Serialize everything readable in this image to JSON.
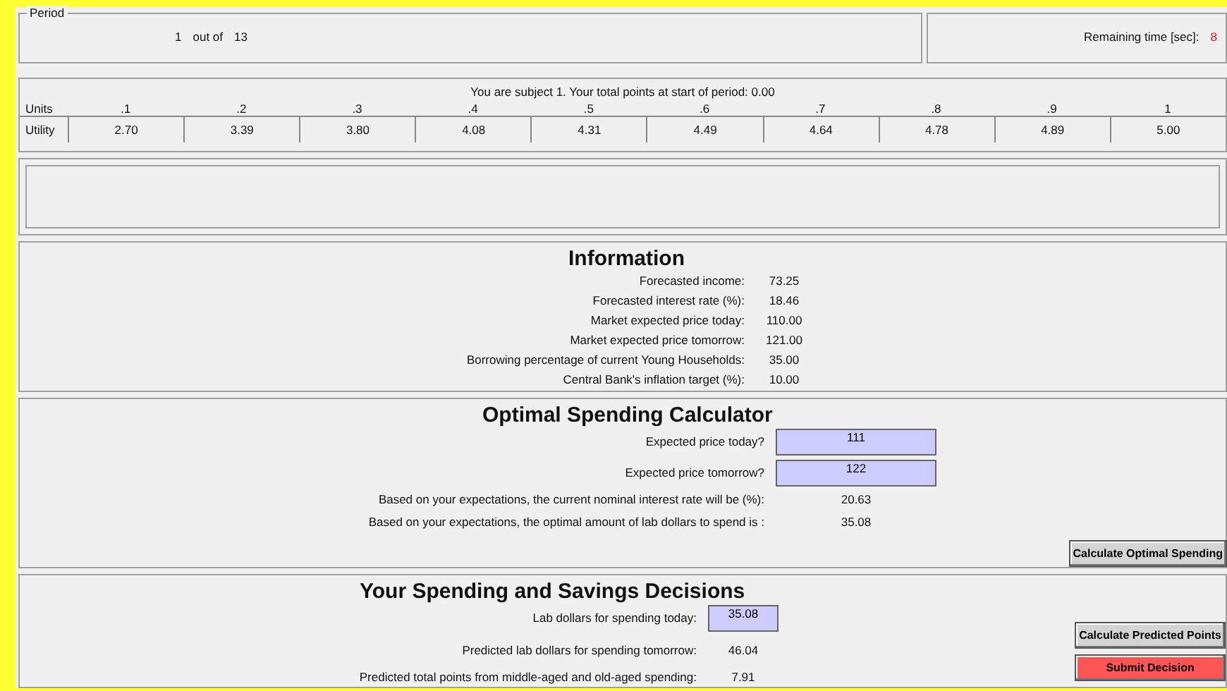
{
  "period": {
    "legend": "Period",
    "current": "1",
    "out_of_label": "out of",
    "total": "13"
  },
  "timer": {
    "label": "Remaining time [sec]:",
    "value": "8"
  },
  "subject_line": "You are subject 1. Your total points at start of period: 0.00",
  "utility_table": {
    "row_headers": [
      "Units",
      "Utility"
    ],
    "units": [
      ".1",
      ".2",
      ".3",
      ".4",
      ".5",
      ".6",
      ".7",
      ".8",
      ".9",
      "1"
    ],
    "utility": [
      "2.70",
      "3.39",
      "3.80",
      "4.08",
      "4.31",
      "4.49",
      "4.64",
      "4.78",
      "4.89",
      "5.00"
    ]
  },
  "information": {
    "title": "Information",
    "rows": [
      {
        "label": "Forecasted income:",
        "value": "73.25"
      },
      {
        "label": "Forecasted interest rate (%):",
        "value": "18.46"
      },
      {
        "label": "Market expected price today:",
        "value": "110.00"
      },
      {
        "label": "Market expected price tomorrow:",
        "value": "121.00"
      },
      {
        "label": "Borrowing percentage of current Young Households:",
        "value": "35.00"
      },
      {
        "label": "Central Bank's inflation target (%):",
        "value": "10.00"
      }
    ]
  },
  "calculator": {
    "title": "Optimal Spending Calculator",
    "rows": [
      {
        "kind": "field",
        "label": "Expected price today?",
        "value": "111"
      },
      {
        "kind": "field",
        "label": "Expected price tomorrow?",
        "value": "122"
      },
      {
        "kind": "text",
        "label": "Based on your expectations, the current nominal interest rate will be (%):",
        "value": "20.63"
      },
      {
        "kind": "text",
        "label": "Based on your  expectations, the optimal amount of lab dollars to spend is :",
        "value": "35.08"
      }
    ],
    "button": "Calculate Optimal Spending"
  },
  "decisions": {
    "title": "Your Spending and Savings Decisions",
    "rows": [
      {
        "kind": "field",
        "label": "Lab dollars for spending today:",
        "value": "35.08"
      },
      {
        "kind": "text",
        "label": "Predicted lab dollars for spending tomorrow:",
        "value": "46.04"
      },
      {
        "kind": "text",
        "label": "Predicted total points from middle-aged and old-aged spending:",
        "value": "7.91"
      }
    ],
    "buttons": [
      {
        "kind": "plain",
        "label": "Calculate Predicted Points"
      },
      {
        "kind": "submit",
        "label": "Submit Decision"
      }
    ]
  }
}
